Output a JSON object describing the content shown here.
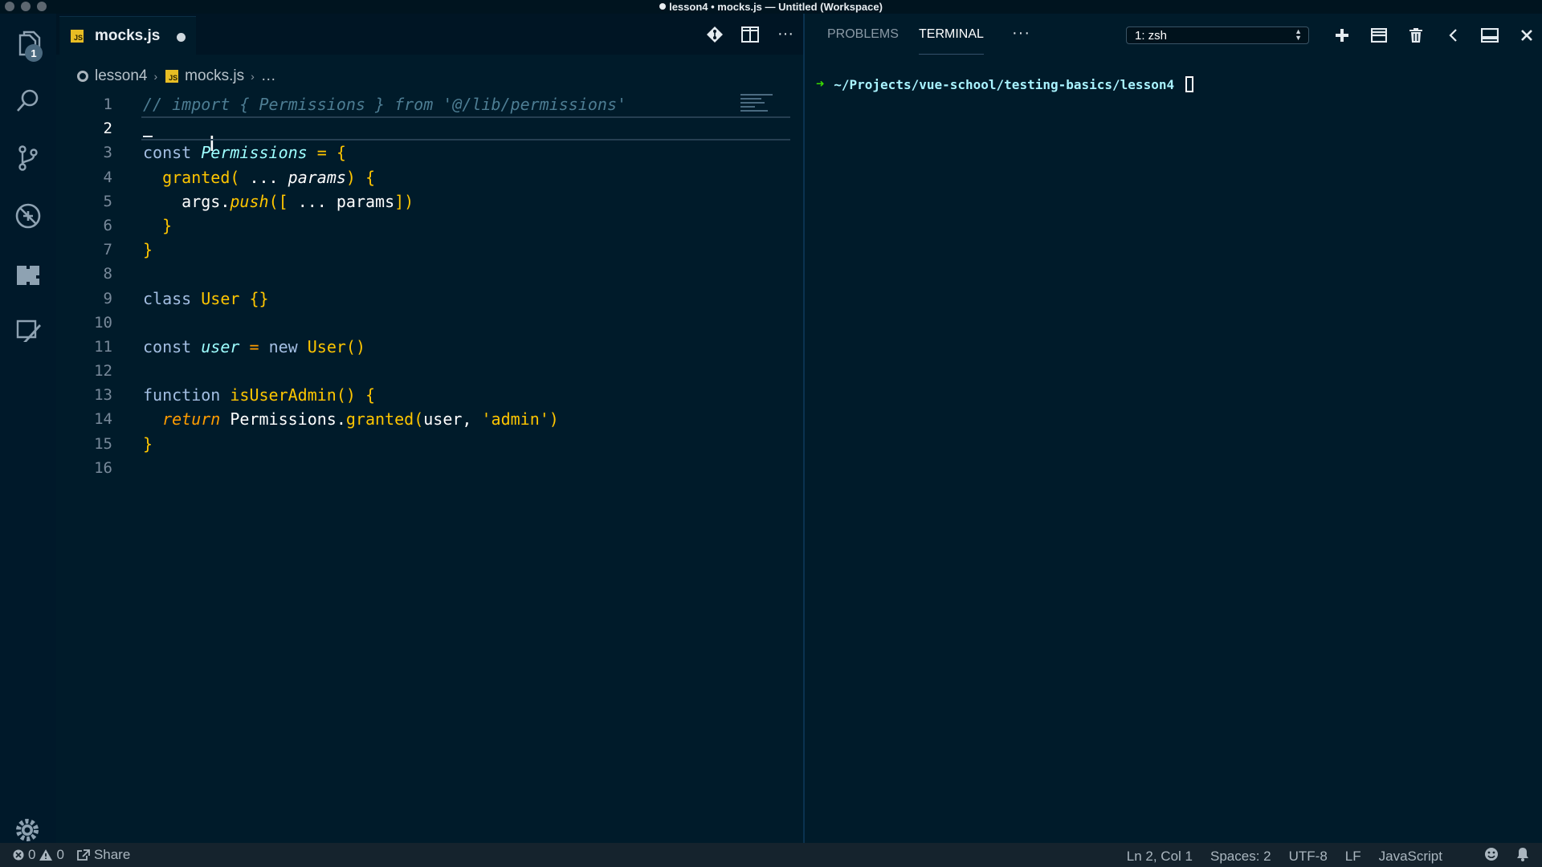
{
  "window": {
    "title": "lesson4 • mocks.js — Untitled (Workspace)"
  },
  "activity": {
    "explorer_badge": "1"
  },
  "editor": {
    "tab": {
      "label": "mocks.js",
      "icon_text": "JS"
    },
    "breadcrumb": {
      "folder": "lesson4",
      "file": "mocks.js",
      "more": "…"
    },
    "current_line": 2,
    "lines": [
      {
        "n": "1"
      },
      {
        "n": "2"
      },
      {
        "n": "3"
      },
      {
        "n": "4"
      },
      {
        "n": "5"
      },
      {
        "n": "6"
      },
      {
        "n": "7"
      },
      {
        "n": "8"
      },
      {
        "n": "9"
      },
      {
        "n": "10"
      },
      {
        "n": "11"
      },
      {
        "n": "12"
      },
      {
        "n": "13"
      },
      {
        "n": "14"
      },
      {
        "n": "15"
      },
      {
        "n": "16"
      }
    ],
    "code": {
      "l1": "// import { Permissions } from '@/lib/permissions'",
      "l3_kw": "const",
      "l3_var": "Permissions",
      "l3_rest": " = {",
      "l4_fn": "granted",
      "l4_p1": "(",
      "l4_spread": " ... ",
      "l4_param": "params",
      "l4_p2": ") {",
      "l5_obj": "args",
      "l5_dot": ".",
      "l5_fn": "push",
      "l5_p": "([",
      "l5_spread": " ... ",
      "l5_arg": "params",
      "l5_end": "])",
      "l6": "}",
      "l7": "}",
      "l9_kw": "class",
      "l9_name": "User",
      "l9_rest": "{}",
      "l11_kw": "const",
      "l11_var": "user",
      "l11_eq": "=",
      "l11_new": "new",
      "l11_cls": "User",
      "l11_end": "()",
      "l13_kw": "function",
      "l13_name": "isUserAdmin",
      "l13_rest": "() {",
      "l14_ret": "return",
      "l14_obj": "Permissions",
      "l14_dot": ".",
      "l14_fn": "granted",
      "l14_p": "(",
      "l14_a1": "user",
      "l14_c": ",",
      "l14_str": "'admin'",
      "l14_end": ")",
      "l15": "}"
    }
  },
  "panel": {
    "tabs": [
      "PROBLEMS",
      "TERMINAL"
    ],
    "more": "···",
    "terminal_select": "1: zsh",
    "prompt_arrow": "➜",
    "prompt_path": "~/Projects/vue-school/testing-basics/lesson4"
  },
  "status": {
    "errors": "0",
    "warnings": "0",
    "share": "Share",
    "position": "Ln 2, Col 1",
    "spaces": "Spaces: 2",
    "encoding": "UTF-8",
    "eol": "LF",
    "language": "JavaScript"
  }
}
